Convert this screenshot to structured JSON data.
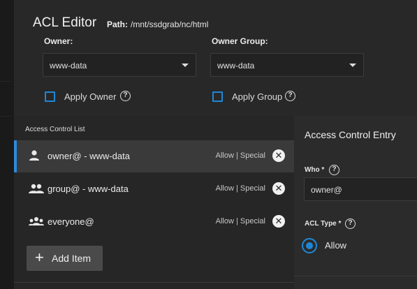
{
  "editor": {
    "title": "ACL Editor",
    "path_label": "Path:",
    "path_value": "/mnt/ssdgrab/nc/html"
  },
  "owner": {
    "label": "Owner:",
    "value": "www-data",
    "apply_label": "Apply Owner"
  },
  "owner_group": {
    "label": "Owner Group:",
    "value": "www-data",
    "apply_label": "Apply Group"
  },
  "acl_list": {
    "title": "Access Control List",
    "items": [
      {
        "name": "owner@ - www-data",
        "permission": "Allow | Special",
        "icon": "person-icon",
        "selected": true
      },
      {
        "name": "group@ - www-data",
        "permission": "Allow | Special",
        "icon": "group-icon",
        "selected": false
      },
      {
        "name": "everyone@",
        "permission": "Allow | Special",
        "icon": "groups-icon",
        "selected": false
      }
    ],
    "add_label": "Add Item"
  },
  "entry": {
    "title": "Access Control Entry",
    "who_label": "Who *",
    "who_value": "owner@",
    "acl_type_label": "ACL Type *",
    "acl_type_value": "Allow"
  },
  "colors": {
    "accent": "#1e88d8",
    "background": "#1d1d1d",
    "panel": "#282828",
    "selected_row": "#3a3a3a"
  }
}
